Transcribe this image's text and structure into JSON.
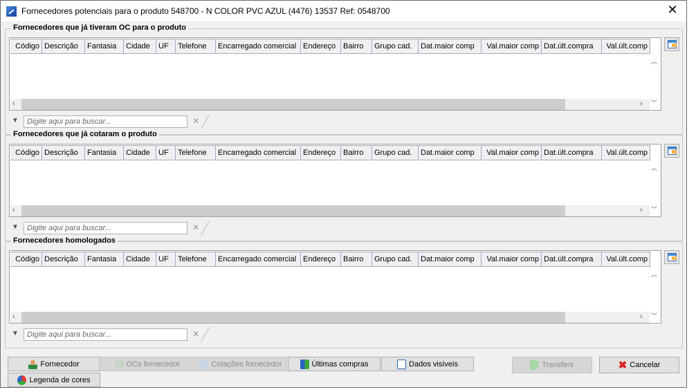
{
  "window": {
    "title": "Fornecedores potenciais para o produto 548700 - N COLOR PVC AZUL (4476) 13537 Ref: 0548700"
  },
  "columns": [
    "Código",
    "Descrição",
    "Fantasia",
    "Cidade",
    "UF",
    "Telefone",
    "Encarregado comercial",
    "Endereço",
    "Bairro",
    "Grupo cad.",
    "Dat.maior comp",
    "Val.maior comp",
    "Dat.últ.compra",
    "Val.últ.comp"
  ],
  "sections": [
    {
      "title": "Fornecedores que já tiveram OC para o produto",
      "search_placeholder": "Digite aqui para buscar..."
    },
    {
      "title": "Fornecedores que já cotaram o produto",
      "search_placeholder": "Digite aqui para buscar..."
    },
    {
      "title": "Fornecedores homologados",
      "search_placeholder": "Digite aqui para buscar..."
    }
  ],
  "buttons": {
    "fornecedor": "Fornecedor",
    "ocs": "OCs fornecedor",
    "cotacoes": "Cotações fornecedor",
    "ultimas": "Últimas compras",
    "dados": "Dados visíveis",
    "transferir": "Transferir",
    "cancelar": "Cancelar",
    "legenda": "Legenda de cores"
  }
}
